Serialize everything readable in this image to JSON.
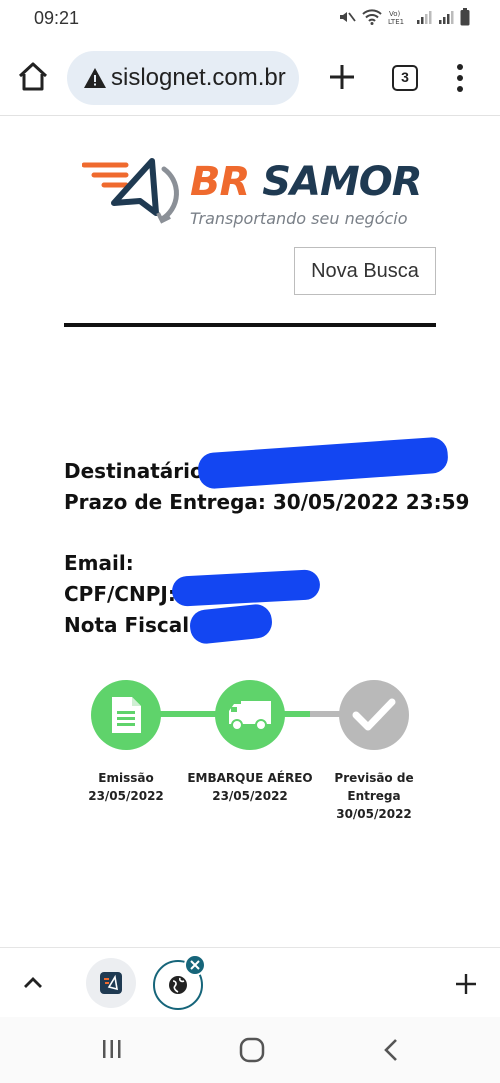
{
  "status_bar": {
    "time": "09:21",
    "icons": [
      "mute-icon",
      "wifi-icon",
      "volte-icon",
      "signal-icon",
      "signal-icon",
      "battery-icon"
    ]
  },
  "browser": {
    "url": "sislognet.com.br",
    "tab_count": "3",
    "icons": [
      "home-icon",
      "warning-icon",
      "plus-icon",
      "tabs-icon",
      "menu-dots-icon"
    ]
  },
  "page": {
    "logo": {
      "brand_first": "BR",
      "brand_second": "SAMOR",
      "tagline": "Transportando seu negócio",
      "colors": {
        "orange": "#ef6a2e",
        "navy": "#1f3a52",
        "gray": "#7a8088"
      }
    },
    "nova_busca_label": "Nova Busca",
    "info": {
      "destinatario_label": "Destinatário:",
      "prazo_label": "Prazo de Entrega: 30/05/2022 23:59",
      "email_label": "Email:",
      "cpf_label": "CPF/CNPJ:",
      "nota_label": "Nota Fiscal:"
    },
    "timeline": {
      "colors": {
        "done": "#5fd36b",
        "pending": "#b9b9b9"
      },
      "steps": [
        {
          "name": "Emissão",
          "date": "23/05/2022",
          "status": "done",
          "icon": "document-icon"
        },
        {
          "name": "EMBARQUE AÉREO",
          "date": "23/05/2022",
          "status": "done",
          "icon": "truck-icon"
        },
        {
          "name": "Previsão de Entrega",
          "date": "30/05/2022",
          "status": "pending",
          "icon": "checkmark-icon"
        }
      ]
    }
  },
  "tab_strip": {
    "icons": [
      "chevron-up-icon",
      "site-favicon-icon",
      "globe-icon",
      "close-icon",
      "plus-icon"
    ]
  },
  "system_nav": {
    "icons": [
      "recents-icon",
      "home-circle-icon",
      "back-icon"
    ]
  }
}
